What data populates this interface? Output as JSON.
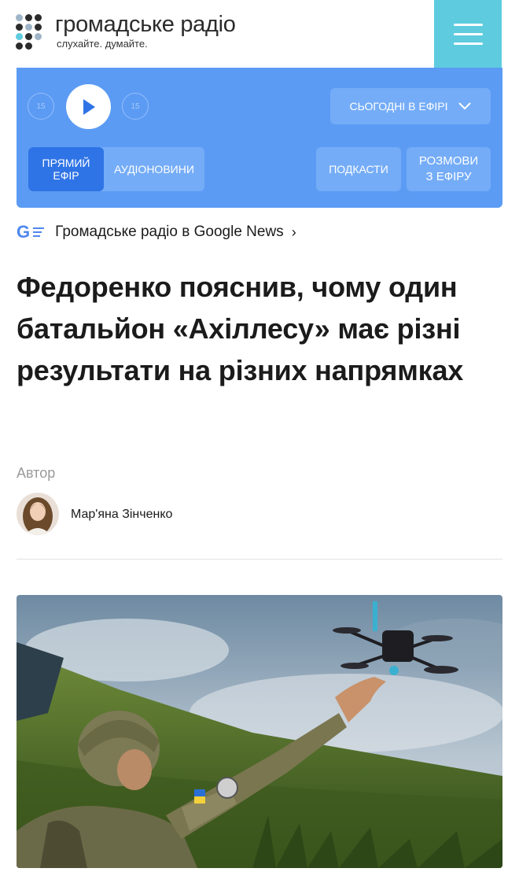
{
  "header": {
    "logo_title": "громадське радіо",
    "logo_subtitle": "слухайте. думайте."
  },
  "player": {
    "skip_back_label": "15",
    "skip_forward_label": "15",
    "today_label": "СЬОГОДНІ В ЕФІРІ",
    "tabs": [
      {
        "label_line1": "ПРЯМИЙ",
        "label_line2": "ЕФІР",
        "active": true
      },
      {
        "label": "АУДІОНОВИНИ",
        "active": false
      }
    ],
    "podcasts_label": "ПОДКАСТИ",
    "talks_line1": "РОЗМОВИ",
    "talks_line2": "З ЕФІРУ"
  },
  "google_news": {
    "text": "Громадське радіо в Google News",
    "chevron": "›"
  },
  "article": {
    "headline": "Федоренко пояснив, чому один батальйон «Ахіллесу» має різні результати на різних напрямках",
    "author_label": "Автор",
    "author_name": "Мар'яна Зінченко"
  },
  "colors": {
    "accent_cyan": "#5ecbdf",
    "player_blue": "#5b9bf4",
    "button_blue": "#74acf7",
    "active_tab_blue": "#2f74e6",
    "google_blue": "#4f87ee"
  },
  "icons": {
    "menu": "hamburger-icon",
    "play": "play-icon",
    "skip_back": "rewind-15-icon",
    "skip_forward": "forward-15-icon",
    "today_chevron": "chevron-down-icon",
    "google": "google-news-icon",
    "gnews_chevron": "chevron-right-icon"
  }
}
